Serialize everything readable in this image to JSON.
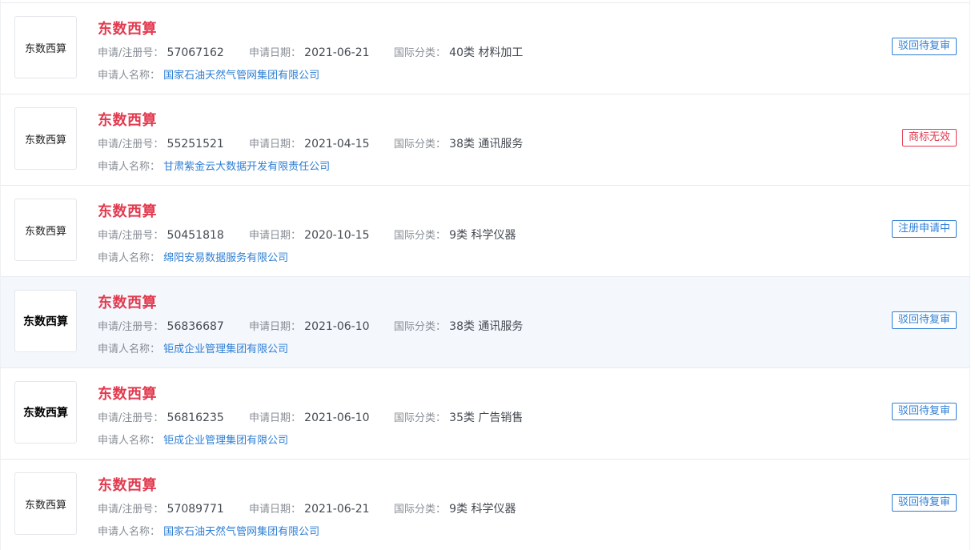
{
  "labels": {
    "reg_no": "申请/注册号：",
    "apply_date": "申请日期：",
    "intl_class": "国际分类：",
    "applicant": "申请人名称："
  },
  "items": [
    {
      "logo_text": "东数西算",
      "name": "东数西算",
      "reg_no": "57067162",
      "apply_date": "2021-06-21",
      "intl_class": "40类 材料加工",
      "applicant": "国家石油天然气管网集团有限公司",
      "status": "驳回待复审"
    },
    {
      "logo_text": "东数西算",
      "name": "东数西算",
      "reg_no": "55251521",
      "apply_date": "2021-04-15",
      "intl_class": "38类 通讯服务",
      "applicant": "甘肃紫金云大数据开发有限责任公司",
      "status": "商标无效"
    },
    {
      "logo_text": "东数西算",
      "name": "东数西算",
      "reg_no": "50451818",
      "apply_date": "2020-10-15",
      "intl_class": "9类 科学仪器",
      "applicant": "绵阳安易数据服务有限公司",
      "status": "注册申请中"
    },
    {
      "logo_text": "东数西算",
      "name": "东数西算",
      "reg_no": "56836687",
      "apply_date": "2021-06-10",
      "intl_class": "38类 通讯服务",
      "applicant": "钜成企业管理集团有限公司",
      "status": "驳回待复审"
    },
    {
      "logo_text": "东数西算",
      "name": "东数西算",
      "reg_no": "56816235",
      "apply_date": "2021-06-10",
      "intl_class": "35类 广告销售",
      "applicant": "钜成企业管理集团有限公司",
      "status": "驳回待复审"
    },
    {
      "logo_text": "东数西算",
      "name": "东数西算",
      "reg_no": "57089771",
      "apply_date": "2021-06-21",
      "intl_class": "9类 科学仪器",
      "applicant": "国家石油天然气管网集团有限公司",
      "status": "驳回待复审"
    }
  ],
  "colors": {
    "title": "#e23b50",
    "link": "#2f7fd4",
    "status_blue": "#2f7fd4",
    "status_red": "#e23b50",
    "highlight_row": "#f4f7fc"
  }
}
